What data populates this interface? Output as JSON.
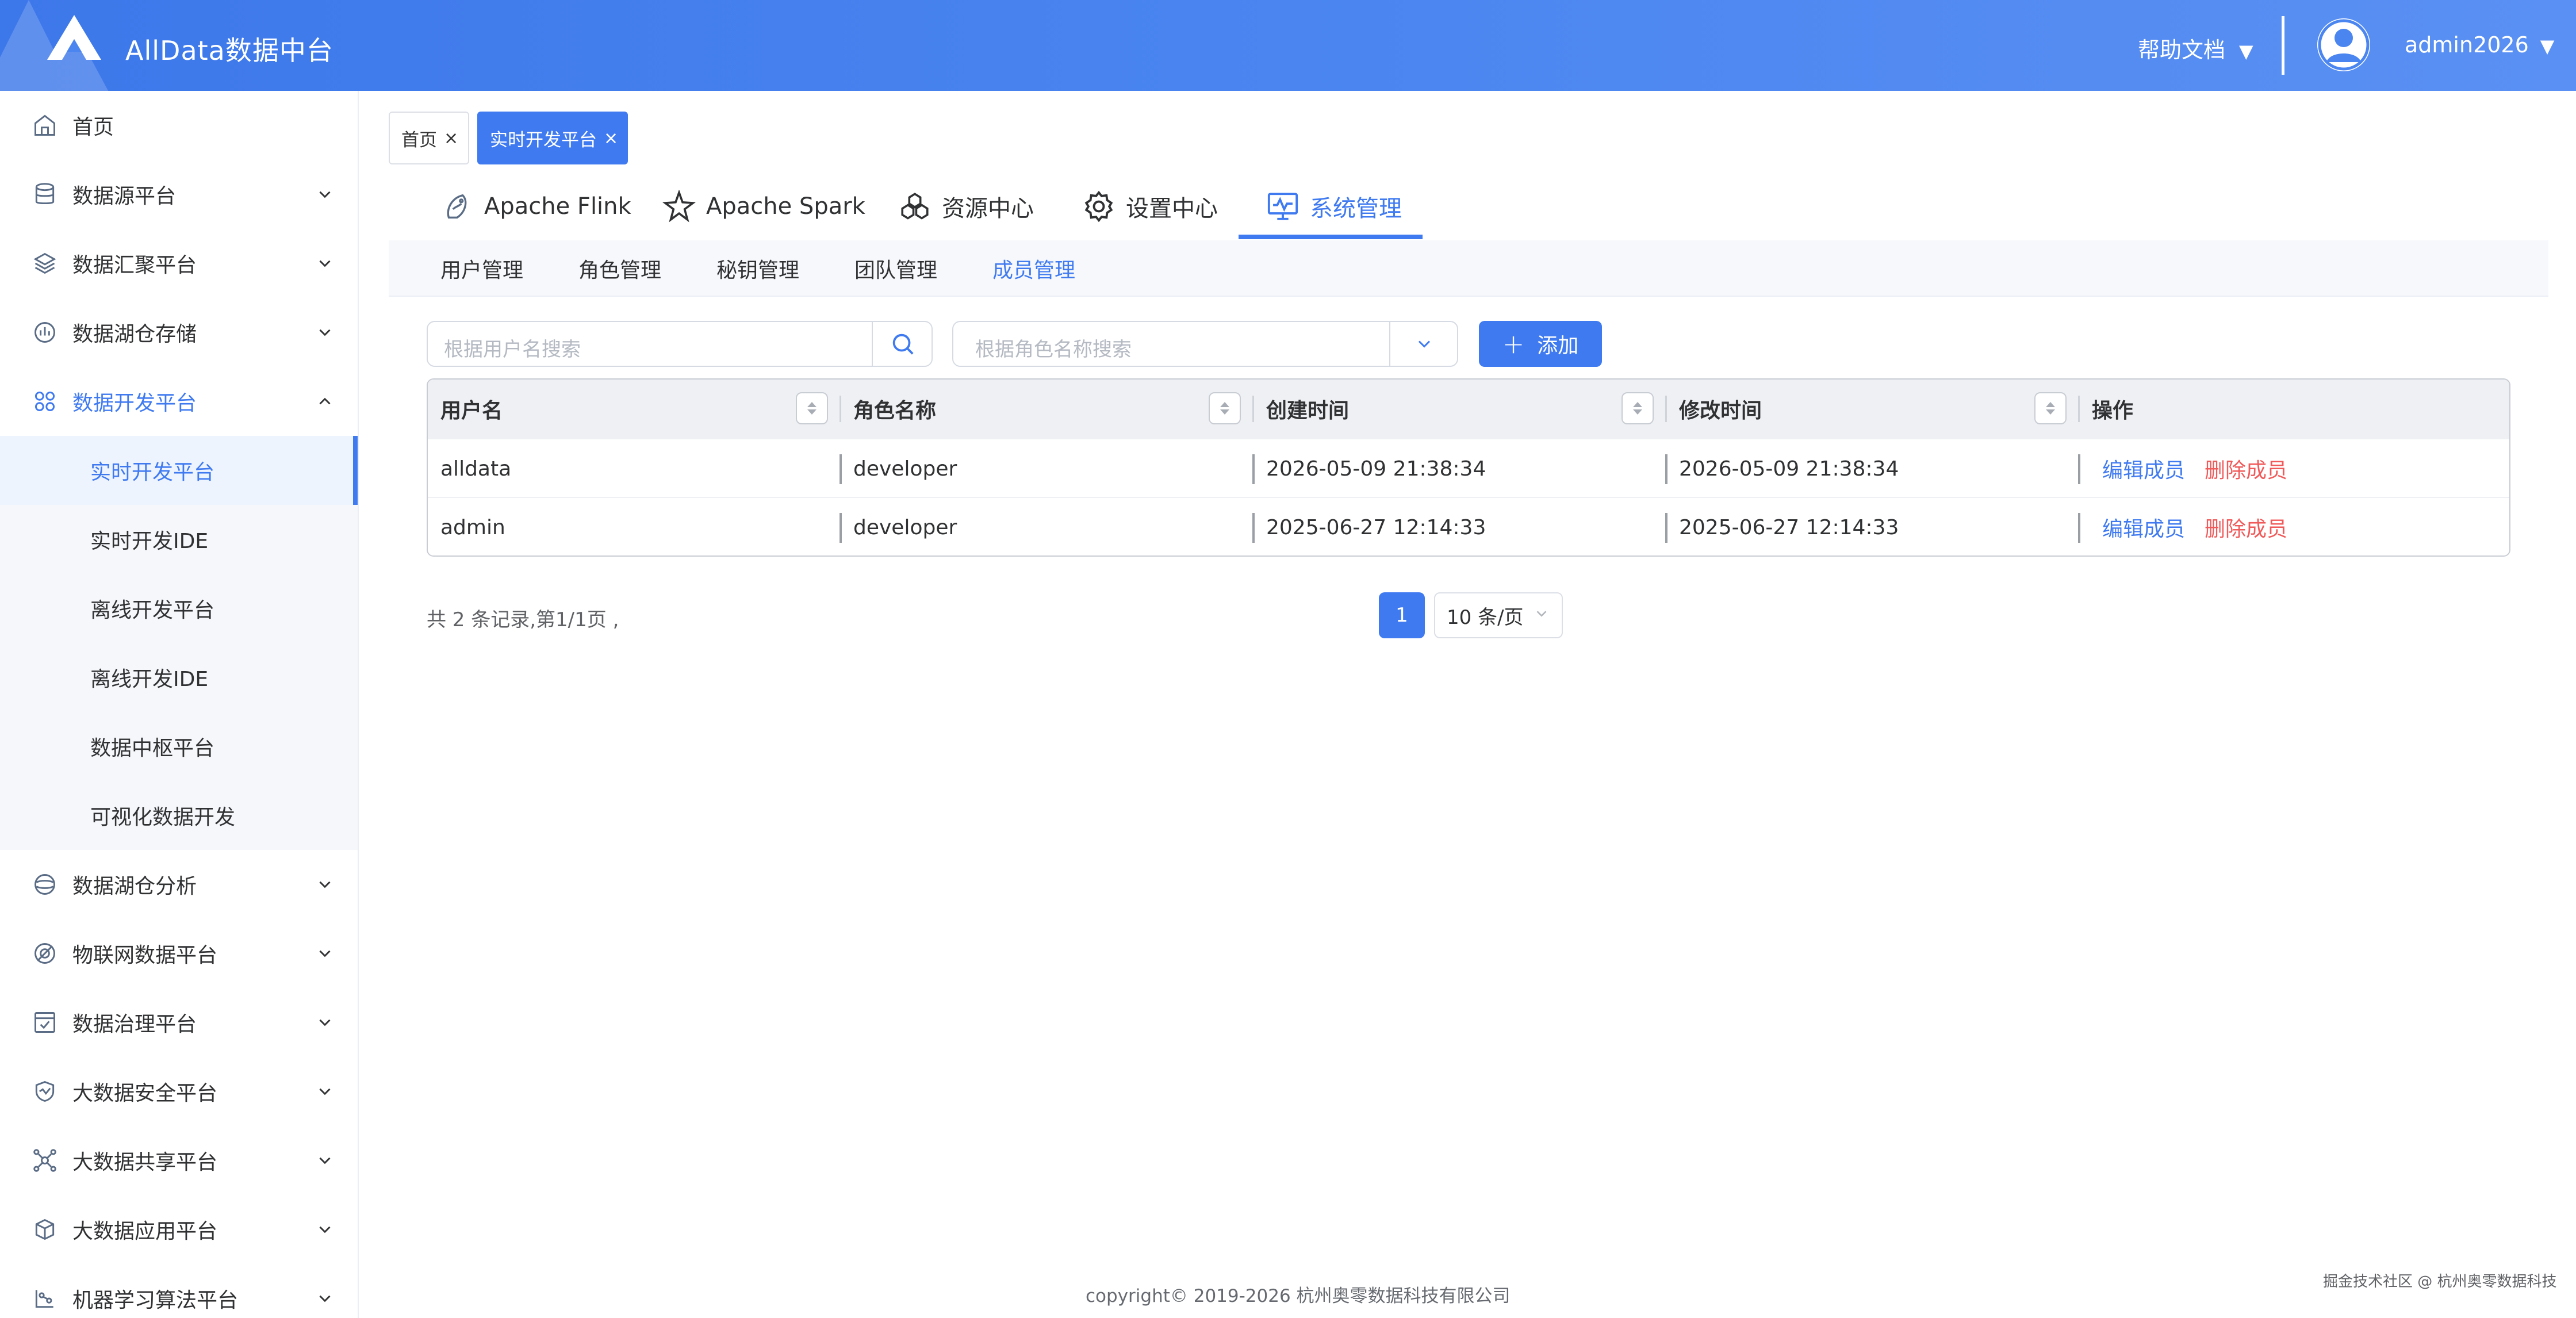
{
  "header": {
    "app_title": "AllData数据中台",
    "help_label": "帮助文档",
    "username": "admin2026",
    "caret": "▼"
  },
  "sidebar": {
    "items": [
      {
        "label": "首页",
        "icon": "home-icon"
      },
      {
        "label": "数据源平台",
        "icon": "database-icon"
      },
      {
        "label": "数据汇聚平台",
        "icon": "layers-icon"
      },
      {
        "label": "数据湖仓存储",
        "icon": "storage-icon"
      },
      {
        "label": "数据开发平台",
        "icon": "grid-icon",
        "expanded": true
      },
      {
        "label": "数据湖仓分析",
        "icon": "lake-icon"
      },
      {
        "label": "物联网数据平台",
        "icon": "iot-icon"
      },
      {
        "label": "数据治理平台",
        "icon": "governance-icon"
      },
      {
        "label": "大数据安全平台",
        "icon": "shield-icon"
      },
      {
        "label": "大数据共享平台",
        "icon": "share-icon"
      },
      {
        "label": "大数据应用平台",
        "icon": "cube-icon"
      },
      {
        "label": "机器学习算法平台",
        "icon": "ml-icon"
      }
    ],
    "sub_items": [
      {
        "label": "实时开发平台",
        "active": true
      },
      {
        "label": "实时开发IDE"
      },
      {
        "label": "离线开发平台"
      },
      {
        "label": "离线开发IDE"
      },
      {
        "label": "数据中枢平台"
      },
      {
        "label": "可视化数据开发"
      }
    ]
  },
  "tags": [
    {
      "label": "首页",
      "close": "×"
    },
    {
      "label": "实时开发平台",
      "close": "×",
      "active": true
    }
  ],
  "tabs": [
    {
      "label": "Apache Flink",
      "icon": "flink-icon"
    },
    {
      "label": "Apache Spark",
      "icon": "spark-icon"
    },
    {
      "label": "资源中心",
      "icon": "resource-icon"
    },
    {
      "label": "设置中心",
      "icon": "gear-icon"
    },
    {
      "label": "系统管理",
      "icon": "monitor-icon",
      "active": true
    }
  ],
  "subtabs": [
    {
      "label": "用户管理"
    },
    {
      "label": "角色管理"
    },
    {
      "label": "秘钥管理"
    },
    {
      "label": "团队管理"
    },
    {
      "label": "成员管理",
      "active": true
    }
  ],
  "search": {
    "user_placeholder": "根据用户名搜索",
    "role_placeholder": "根据角色名称搜索",
    "add_label": "添加",
    "add_symbol": "+"
  },
  "table": {
    "columns": [
      "用户名",
      "角色名称",
      "创建时间",
      "修改时间",
      "操作"
    ],
    "rows": [
      {
        "username": "alldata",
        "role": "developer",
        "created": "2026-05-09 21:38:34",
        "modified": "2026-05-09 21:38:34",
        "edit": "编辑成员",
        "delete": "删除成员"
      },
      {
        "username": "admin",
        "role": "developer",
        "created": "2025-06-27 12:14:33",
        "modified": "2025-06-27 12:14:33",
        "edit": "编辑成员",
        "delete": "删除成员"
      }
    ]
  },
  "pagination": {
    "summary": "共 2 条记录,第1/1页 ,",
    "current_page": "1",
    "page_size": "10 条/页"
  },
  "footer": {
    "copyright": "copyright© 2019-2026 杭州奥零数据科技有限公司",
    "watermark": "掘金技术社区 @ 杭州奥零数据科技"
  },
  "colors": {
    "primary": "#3f7af0",
    "danger": "#f05a5a",
    "header_gradient_start": "#3d78ea",
    "header_gradient_end": "#5a90f3"
  }
}
